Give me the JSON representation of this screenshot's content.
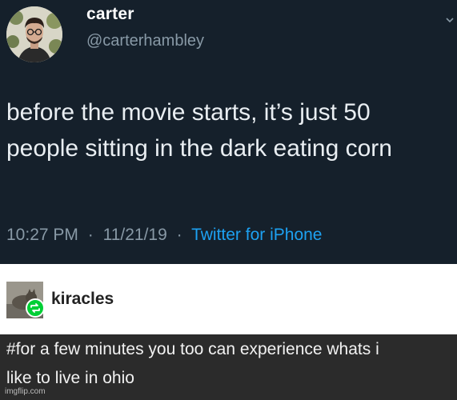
{
  "tweet": {
    "display_name": "carter",
    "handle": "@carterhambley",
    "text_lines": [
      "before the movie starts, it’s just 50",
      "people sitting in the dark eating corn"
    ],
    "time": "10:27 PM",
    "date": "11/21/19",
    "separator": "·",
    "source": "Twitter for iPhone",
    "avatar_icon": "profile-photo",
    "caret_icon": "chevron-down-icon",
    "colors": {
      "background": "#15202b",
      "muted": "#8899a6",
      "link": "#1da1f2"
    }
  },
  "reblog": {
    "username": "kiracles",
    "badge_icon": "reblog-icon",
    "badge_color": "#00cf35"
  },
  "tags": {
    "line1": "#for a few minutes you too can experience whats i",
    "line2": "like to live in ohio"
  },
  "watermark": "imgflip.com"
}
